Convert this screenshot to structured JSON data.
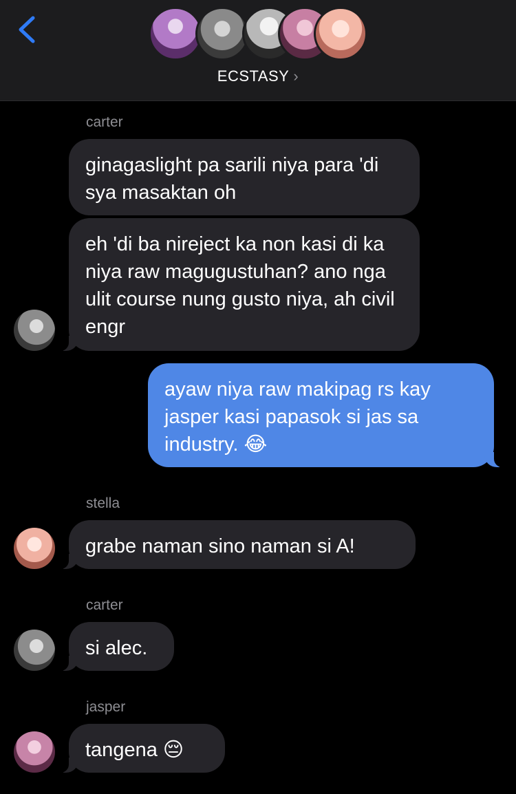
{
  "header": {
    "group_name": "ECSTASY",
    "chevron": "›",
    "back_icon": "chevron-left-icon",
    "accent": "#2f7bf6",
    "member_avatars": [
      "carter",
      "jasper-alt",
      "member-3",
      "jasper",
      "stella"
    ]
  },
  "messages": [
    {
      "sender": "carter",
      "text": "ginagaslight pa sarili niya para 'di sya masaktan oh"
    },
    {
      "text": "eh 'di ba nireject ka non kasi di ka niya raw magugustuhan? ano nga ulit course nung gusto niya, ah civil engr"
    },
    {
      "outgoing": true,
      "text": "ayaw niya raw makipag rs kay jasper kasi papasok si jas sa industry. 😂"
    },
    {
      "sender": "stella",
      "text": "grabe naman sino naman si A!"
    },
    {
      "sender": "carter",
      "text": "si alec."
    },
    {
      "sender": "jasper",
      "text": "tangena 😔"
    }
  ],
  "colors": {
    "background": "#000000",
    "header_bg": "#1c1c1e",
    "incoming_bubble": "#26252a",
    "outgoing_bubble": "#4f87e6",
    "sender_name": "#8e8e93"
  }
}
